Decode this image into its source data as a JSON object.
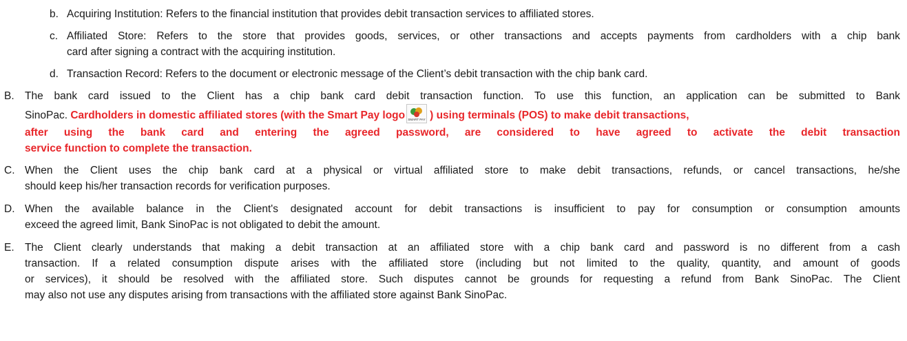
{
  "sub_items": [
    {
      "marker": "b.",
      "lines": [
        "Acquiring Institution: Refers to the financial institution that provides debit transaction services to affiliated stores."
      ]
    },
    {
      "marker": "c.",
      "lines": [
        "Affiliated Store: Refers to the store that provides goods, services, or other transactions and accepts payments from cardholders with a chip bank",
        "card after signing a contract with the acquiring institution."
      ]
    },
    {
      "marker": "d.",
      "lines": [
        "Transaction Record: Refers to the document or electronic message of the Client’s debit transaction with the chip bank card."
      ]
    }
  ],
  "item_b": {
    "marker": "B.",
    "line1": "The bank card issued to the Client has a chip bank card debit transaction function. To use this function, an application can be submitted to Bank",
    "line2_plain": "SinoPac. ",
    "line2_red_a": "Cardholders in domestic affiliated stores (with the Smart Pay logo",
    "line2_red_b": ") using terminals (POS) to make debit transactions,",
    "line3_red": "after using the bank card and entering the agreed password, are considered to have agreed to activate the debit transaction",
    "line4_red": "service function to complete the transaction.",
    "logo_text": "SMART PAY"
  },
  "items": [
    {
      "marker": "C.",
      "lines": [
        "When the Client uses the chip bank card at a physical or virtual affiliated store to make debit transactions, refunds, or cancel transactions, he/she",
        "should keep his/her transaction records for verification purposes."
      ]
    },
    {
      "marker": "D.",
      "lines": [
        "When the available balance in the Client's designated account for debit transactions is insufficient to pay for consumption or consumption amounts",
        "exceed the agreed limit, Bank SinoPac is not obligated to debit the amount."
      ]
    },
    {
      "marker": "E.",
      "lines": [
        "The Client clearly understands that making a debit transaction at an affiliated store with a chip bank card and password is no different from a cash",
        "transaction. If a related consumption dispute arises with the affiliated store (including but not limited to the quality, quantity, and amount of goods",
        "or services), it should be resolved with the affiliated store. Such disputes cannot be grounds for requesting a refund from Bank SinoPac. The Client",
        "may also not use any disputes arising from transactions with the affiliated store against Bank SinoPac."
      ]
    }
  ],
  "colors": {
    "red": "#e8262a",
    "text": "#1a1a1a"
  }
}
